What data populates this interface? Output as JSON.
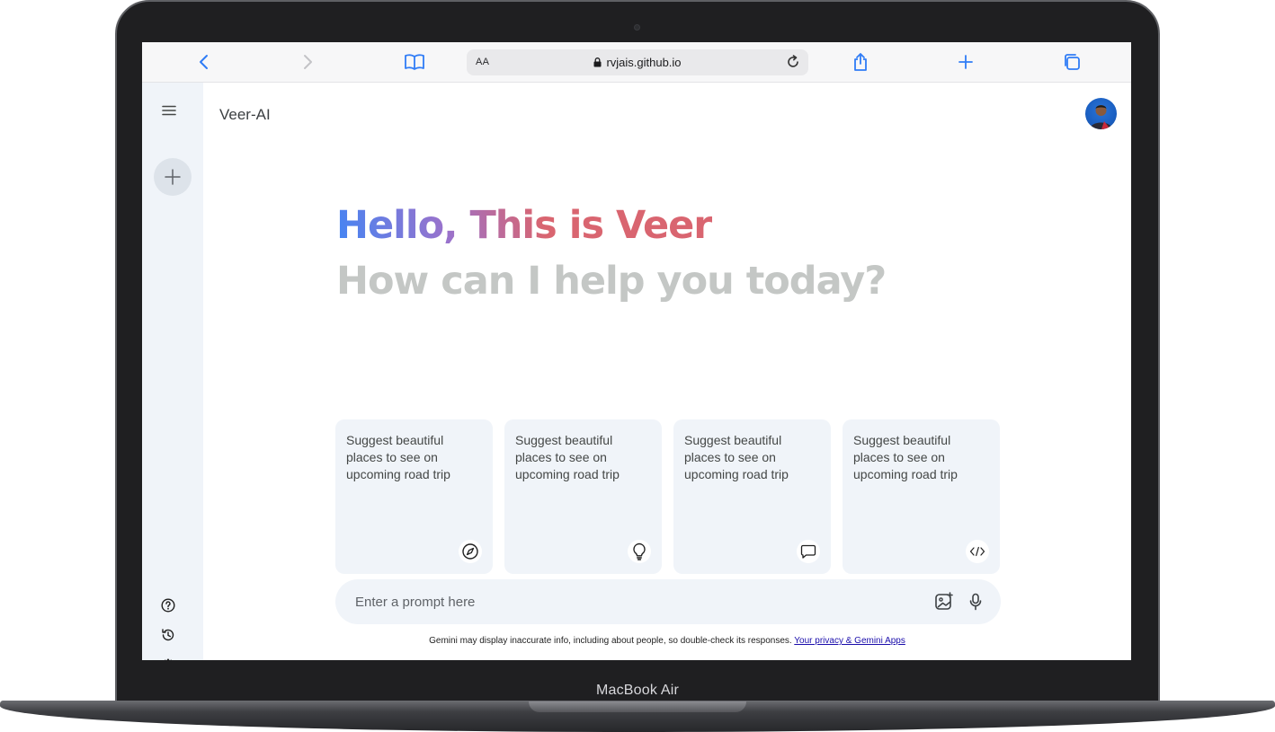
{
  "device": {
    "brand_label": "MacBook Air"
  },
  "browser": {
    "text_size_label": "AA",
    "url": "rvjais.github.io",
    "icons": {
      "back": "chevron-left-icon",
      "forward": "chevron-right-icon",
      "bookmarks": "book-icon",
      "lock": "lock-icon",
      "reload": "reload-icon",
      "share": "share-icon",
      "new_tab": "plus-icon",
      "tabs": "tabs-icon"
    },
    "accent_color": "#2f7cf6"
  },
  "sidebar": {
    "icons": {
      "menu": "menu-icon",
      "new_chat": "plus-icon",
      "help": "help-icon",
      "history": "history-icon",
      "settings": "gear-icon"
    }
  },
  "header": {
    "title": "Veer-AI"
  },
  "greeting": {
    "title": "Hello, This is Veer",
    "subtitle": "How can I help you today?",
    "gradient_colors": [
      "#4285f4",
      "#9b72cb",
      "#d96570"
    ]
  },
  "cards": [
    {
      "text": "Suggest beautiful places to see on upcoming road trip",
      "icon": "compass-icon"
    },
    {
      "text": "Suggest beautiful places to see on upcoming road trip",
      "icon": "bulb-icon"
    },
    {
      "text": "Suggest beautiful places to see on upcoming road trip",
      "icon": "message-icon"
    },
    {
      "text": "Suggest beautiful places to see on upcoming road trip",
      "icon": "code-icon"
    }
  ],
  "prompt": {
    "placeholder": "Enter a prompt here",
    "value": "",
    "icons": {
      "image": "image-add-icon",
      "mic": "mic-icon"
    }
  },
  "footer": {
    "disclaimer": "Gemini may display inaccurate info, including about people, so double-check its responses.",
    "link_text": "Your privacy & Gemini Apps"
  }
}
